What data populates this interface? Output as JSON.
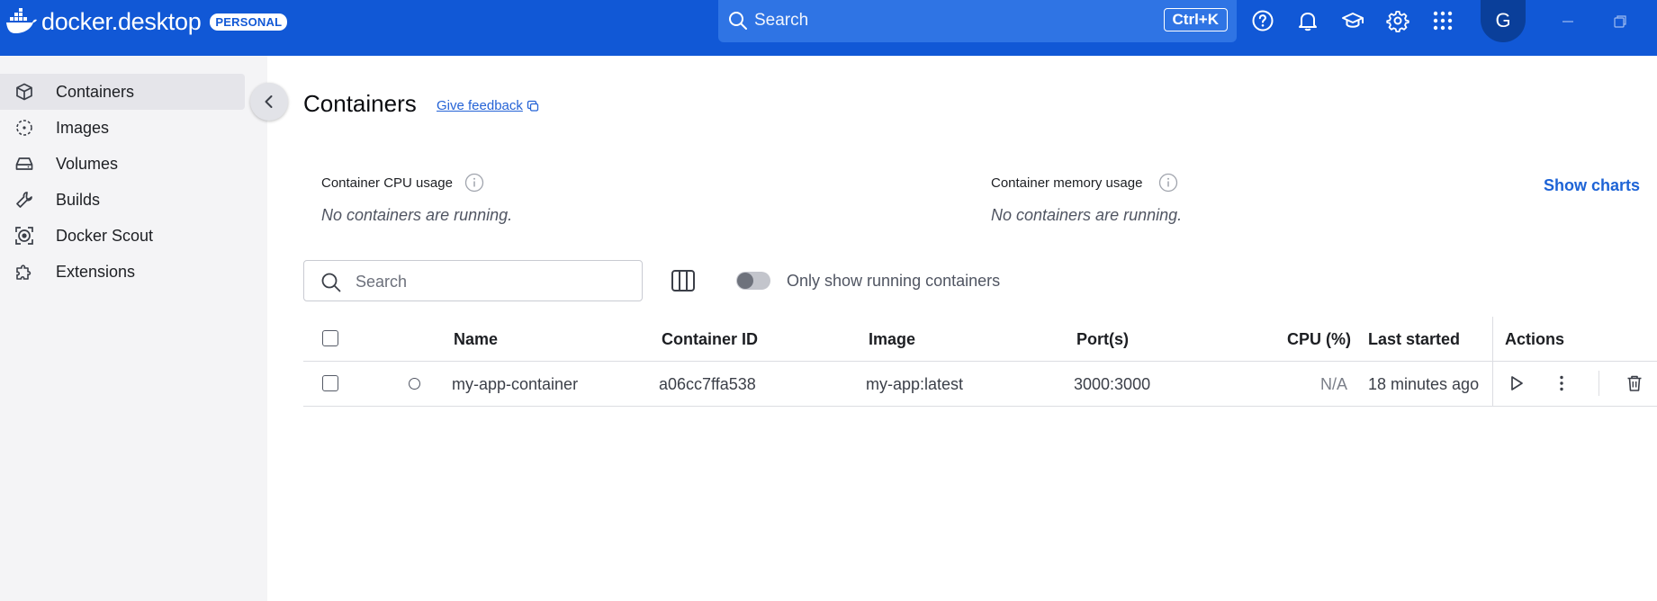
{
  "app": {
    "brand_prefix": "docker",
    "brand_suffix": "desktop",
    "plan_badge": "PERSONAL",
    "brand_color": "#1158d6"
  },
  "topbar": {
    "search_placeholder": "Search",
    "search_shortcut": "Ctrl+K",
    "icons": [
      "help-icon",
      "bell-icon",
      "learning-center-icon",
      "gear-icon",
      "apps-grid-icon"
    ],
    "avatar_initial": "G"
  },
  "sidebar": {
    "items": [
      {
        "label": "Containers",
        "icon": "container-icon",
        "active": true
      },
      {
        "label": "Images",
        "icon": "image-icon",
        "active": false
      },
      {
        "label": "Volumes",
        "icon": "volume-icon",
        "active": false
      },
      {
        "label": "Builds",
        "icon": "wrench-icon",
        "active": false
      },
      {
        "label": "Docker Scout",
        "icon": "scout-icon",
        "active": false
      },
      {
        "label": "Extensions",
        "icon": "puzzle-icon",
        "active": false
      }
    ]
  },
  "main": {
    "title": "Containers",
    "feedback_link": "Give feedback",
    "cpu_usage": {
      "label": "Container CPU usage",
      "empty": "No containers are running."
    },
    "memory_usage": {
      "label": "Container memory usage",
      "empty": "No containers are running."
    },
    "show_charts": "Show charts",
    "search_placeholder": "Search",
    "running_only_label": "Only show running containers",
    "running_only_checked": false
  },
  "table": {
    "columns": [
      "Name",
      "Container ID",
      "Image",
      "Port(s)",
      "CPU (%)",
      "Last started",
      "Actions"
    ],
    "rows": [
      {
        "name": "my-app-container",
        "container_id": "a06cc7ffa538",
        "image": "my-app:latest",
        "ports": "3000:3000",
        "cpu": "N/A",
        "last_started": "18 minutes ago",
        "status": "stopped"
      }
    ],
    "row_actions": [
      "play-icon",
      "more-vertical-icon",
      "trash-icon"
    ]
  }
}
